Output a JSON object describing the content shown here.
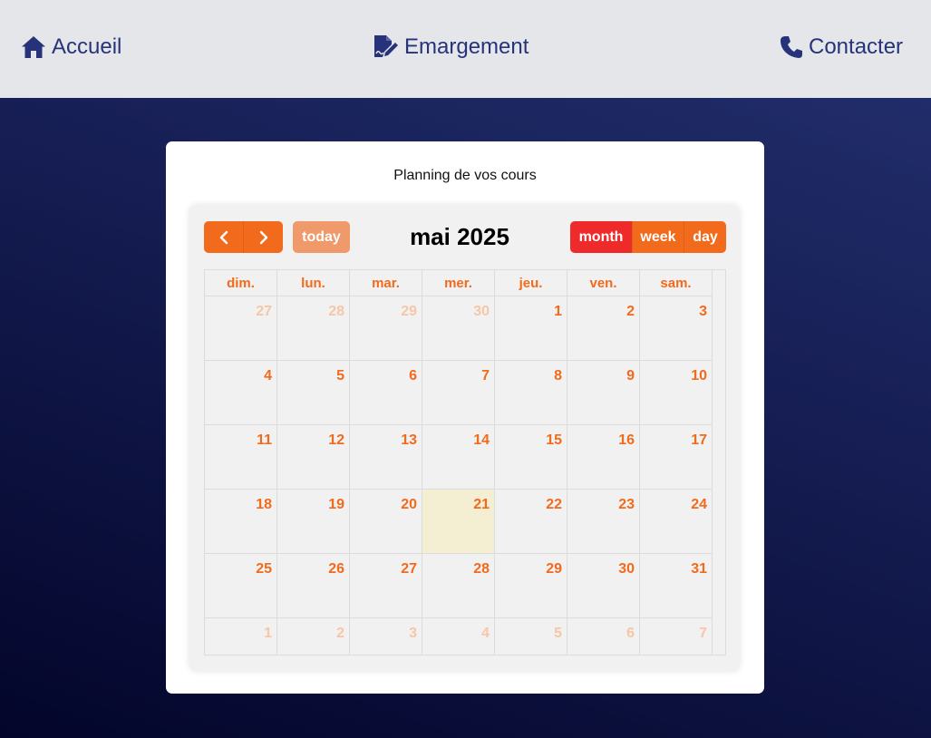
{
  "nav": {
    "home": "Accueil",
    "attendance": "Emargement",
    "contact": "Contacter"
  },
  "card": {
    "title": "Planning de vos cours"
  },
  "calendar": {
    "title": "mai 2025",
    "buttons": {
      "prev_icon": "chevron-left-icon",
      "next_icon": "chevron-right-icon",
      "today": "today",
      "month": "month",
      "week": "week",
      "day": "day"
    },
    "weekdays": [
      "dim.",
      "lun.",
      "mar.",
      "mer.",
      "jeu.",
      "ven.",
      "sam."
    ],
    "weeks": [
      [
        {
          "d": "27",
          "other": true
        },
        {
          "d": "28",
          "other": true
        },
        {
          "d": "29",
          "other": true
        },
        {
          "d": "30",
          "other": true
        },
        {
          "d": "1"
        },
        {
          "d": "2"
        },
        {
          "d": "3"
        }
      ],
      [
        {
          "d": "4"
        },
        {
          "d": "5"
        },
        {
          "d": "6"
        },
        {
          "d": "7"
        },
        {
          "d": "8"
        },
        {
          "d": "9"
        },
        {
          "d": "10"
        }
      ],
      [
        {
          "d": "11"
        },
        {
          "d": "12"
        },
        {
          "d": "13"
        },
        {
          "d": "14"
        },
        {
          "d": "15"
        },
        {
          "d": "16"
        },
        {
          "d": "17"
        }
      ],
      [
        {
          "d": "18"
        },
        {
          "d": "19"
        },
        {
          "d": "20"
        },
        {
          "d": "21",
          "today": true
        },
        {
          "d": "22"
        },
        {
          "d": "23"
        },
        {
          "d": "24"
        }
      ],
      [
        {
          "d": "25"
        },
        {
          "d": "26"
        },
        {
          "d": "27"
        },
        {
          "d": "28"
        },
        {
          "d": "29"
        },
        {
          "d": "30"
        },
        {
          "d": "31"
        }
      ],
      [
        {
          "d": "1",
          "other": true
        },
        {
          "d": "2",
          "other": true
        },
        {
          "d": "3",
          "other": true
        },
        {
          "d": "4",
          "other": true
        },
        {
          "d": "5",
          "other": true
        },
        {
          "d": "6",
          "other": true
        },
        {
          "d": "7",
          "other": true
        }
      ]
    ]
  },
  "colors": {
    "accent": "#f26a1b",
    "active_view": "#ee2a2a",
    "nav_text": "#26337a",
    "today_bg": "#f4eed3"
  }
}
